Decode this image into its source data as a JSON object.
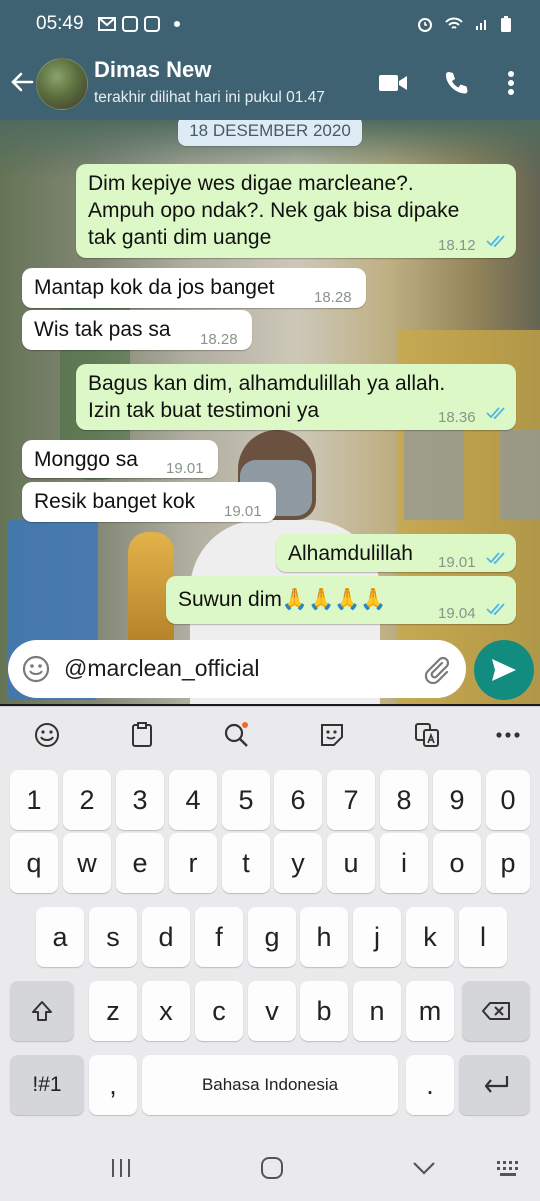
{
  "status_bar": {
    "time": "05:49",
    "icons": [
      "gmail-icon",
      "app-icon",
      "app-icon",
      "more-dot"
    ],
    "right_icons": [
      "alarm-icon",
      "wifi-icon",
      "signal-icon",
      "battery-icon"
    ]
  },
  "header": {
    "name": "Dimas New",
    "status": "terakhir dilihat hari ini pukul 01.47"
  },
  "chat": {
    "date": "18 DESEMBER 2020",
    "messages": [
      {
        "direction": "out",
        "lines": [
          "Dim kepiye wes digae marcleane?.",
          "Ampuh opo ndak?. Nek gak bisa dipake",
          "tak ganti dim uange"
        ],
        "time": "18.12",
        "read": true
      },
      {
        "direction": "in",
        "lines": [
          "Mantap kok da jos banget"
        ],
        "time": "18.28"
      },
      {
        "direction": "in",
        "lines": [
          "Wis tak pas sa"
        ],
        "time": "18.28"
      },
      {
        "direction": "out",
        "lines": [
          "Bagus kan dim, alhamdulillah ya allah.",
          "Izin tak buat testimoni ya"
        ],
        "time": "18.36",
        "read": true
      },
      {
        "direction": "in",
        "lines": [
          "Monggo sa"
        ],
        "time": "19.01"
      },
      {
        "direction": "in",
        "lines": [
          "Resik banget kok"
        ],
        "time": "19.01"
      },
      {
        "direction": "out",
        "lines": [
          "Alhamdulillah"
        ],
        "time": "19.01",
        "read": true
      },
      {
        "direction": "out",
        "lines": [
          "Suwun dim🙏🙏🙏🙏"
        ],
        "time": "19.04",
        "read": true
      }
    ]
  },
  "composer": {
    "value": "@marclean_official"
  },
  "keyboard": {
    "row_numbers": [
      "1",
      "2",
      "3",
      "4",
      "5",
      "6",
      "7",
      "8",
      "9",
      "0"
    ],
    "row1": [
      "q",
      "w",
      "e",
      "r",
      "t",
      "y",
      "u",
      "i",
      "o",
      "p"
    ],
    "row2": [
      "a",
      "s",
      "d",
      "f",
      "g",
      "h",
      "j",
      "k",
      "l"
    ],
    "row3": [
      "z",
      "x",
      "c",
      "v",
      "b",
      "n",
      "m"
    ],
    "symbols_label": "!#1",
    "comma": ",",
    "space_label": "Bahasa Indonesia",
    "period": "."
  },
  "colors": {
    "header_bg": "#3f6273",
    "outgoing_bubble": "#dcf8c6",
    "incoming_bubble": "#ffffff",
    "send_button": "#128c7e",
    "read_ticks": "#4fb6ec"
  }
}
